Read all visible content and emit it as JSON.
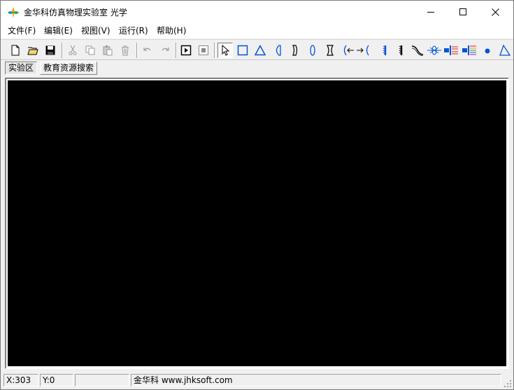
{
  "window": {
    "title": "金华科仿真物理实验室 光学"
  },
  "menu": {
    "items": [
      {
        "label": "文件(F)"
      },
      {
        "label": "编辑(E)"
      },
      {
        "label": "视图(V)"
      },
      {
        "label": "运行(R)"
      },
      {
        "label": "帮助(H)"
      }
    ]
  },
  "toolbar": {
    "buttons": [
      "new-file-icon",
      "open-folder-icon",
      "save-icon",
      "cut-icon",
      "copy-icon",
      "paste-icon",
      "delete-icon",
      "undo-icon",
      "redo-icon",
      "run-icon",
      "stop-icon",
      "pointer-icon",
      "rectangle-icon",
      "prism-icon",
      "plano-concave-lens-icon",
      "concave-mirror-icon",
      "convex-lens-icon",
      "concave-lens-icon",
      "light-path-icon",
      "grating-icon",
      "filter-icon",
      "optical-fiber-icon",
      "laser-icon",
      "light-source-icon",
      "spectrum-source-icon",
      "point-source-icon",
      "triangle-tool-icon"
    ],
    "accent": "#0055d4"
  },
  "tabs": [
    {
      "label": "实验区",
      "active": true
    },
    {
      "label": "教育资源搜索",
      "active": false
    }
  ],
  "status": {
    "x": "X:303",
    "y": "Y:0",
    "empty": "",
    "company": "金华科 www.jhksoft.com"
  }
}
